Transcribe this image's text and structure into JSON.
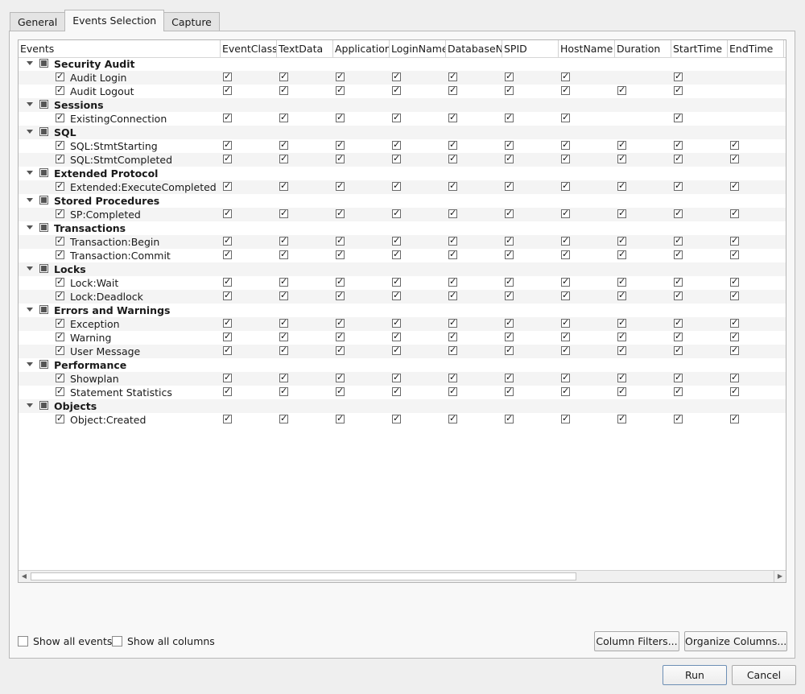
{
  "tabs": [
    "General",
    "Events Selection",
    "Capture"
  ],
  "active_tab": "Events Selection",
  "columns": [
    "Events",
    "EventClass",
    "TextData",
    "ApplicationName",
    "LoginName",
    "DatabaseName",
    "SPID",
    "HostName",
    "Duration",
    "StartTime",
    "EndTime"
  ],
  "categories": [
    {
      "name": "Security Audit",
      "events": [
        {
          "name": "Audit Login",
          "cols": [
            1,
            1,
            1,
            1,
            1,
            1,
            1,
            0,
            1,
            0
          ]
        },
        {
          "name": "Audit Logout",
          "cols": [
            1,
            1,
            1,
            1,
            1,
            1,
            1,
            1,
            1,
            0
          ]
        }
      ]
    },
    {
      "name": "Sessions",
      "events": [
        {
          "name": "ExistingConnection",
          "cols": [
            1,
            1,
            1,
            1,
            1,
            1,
            1,
            0,
            1,
            0
          ]
        }
      ]
    },
    {
      "name": "SQL",
      "events": [
        {
          "name": "SQL:StmtStarting",
          "cols": [
            1,
            1,
            1,
            1,
            1,
            1,
            1,
            1,
            1,
            1
          ]
        },
        {
          "name": "SQL:StmtCompleted",
          "cols": [
            1,
            1,
            1,
            1,
            1,
            1,
            1,
            1,
            1,
            1
          ]
        }
      ]
    },
    {
      "name": "Extended Protocol",
      "events": [
        {
          "name": "Extended:ExecuteCompleted",
          "cols": [
            1,
            1,
            1,
            1,
            1,
            1,
            1,
            1,
            1,
            1
          ]
        }
      ]
    },
    {
      "name": "Stored Procedures",
      "events": [
        {
          "name": "SP:Completed",
          "cols": [
            1,
            1,
            1,
            1,
            1,
            1,
            1,
            1,
            1,
            1
          ]
        }
      ]
    },
    {
      "name": "Transactions",
      "events": [
        {
          "name": "Transaction:Begin",
          "cols": [
            1,
            1,
            1,
            1,
            1,
            1,
            1,
            1,
            1,
            1
          ]
        },
        {
          "name": "Transaction:Commit",
          "cols": [
            1,
            1,
            1,
            1,
            1,
            1,
            1,
            1,
            1,
            1
          ]
        }
      ]
    },
    {
      "name": "Locks",
      "events": [
        {
          "name": "Lock:Wait",
          "cols": [
            1,
            1,
            1,
            1,
            1,
            1,
            1,
            1,
            1,
            1
          ]
        },
        {
          "name": "Lock:Deadlock",
          "cols": [
            1,
            1,
            1,
            1,
            1,
            1,
            1,
            1,
            1,
            1
          ]
        }
      ]
    },
    {
      "name": "Errors and Warnings",
      "events": [
        {
          "name": "Exception",
          "cols": [
            1,
            1,
            1,
            1,
            1,
            1,
            1,
            1,
            1,
            1
          ]
        },
        {
          "name": "Warning",
          "cols": [
            1,
            1,
            1,
            1,
            1,
            1,
            1,
            1,
            1,
            1
          ]
        },
        {
          "name": "User Message",
          "cols": [
            1,
            1,
            1,
            1,
            1,
            1,
            1,
            1,
            1,
            1
          ]
        }
      ]
    },
    {
      "name": "Performance",
      "events": [
        {
          "name": "Showplan",
          "cols": [
            1,
            1,
            1,
            1,
            1,
            1,
            1,
            1,
            1,
            1
          ]
        },
        {
          "name": "Statement Statistics",
          "cols": [
            1,
            1,
            1,
            1,
            1,
            1,
            1,
            1,
            1,
            1
          ]
        }
      ]
    },
    {
      "name": "Objects",
      "events": [
        {
          "name": "Object:Created",
          "cols": [
            1,
            1,
            1,
            1,
            1,
            1,
            1,
            1,
            1,
            1
          ]
        }
      ]
    }
  ],
  "options": {
    "show_all_events": "Show all events",
    "show_all_columns": "Show all columns"
  },
  "buttons": {
    "column_filters": "Column Filters...",
    "organize_columns": "Organize Columns...",
    "run": "Run",
    "cancel": "Cancel"
  }
}
